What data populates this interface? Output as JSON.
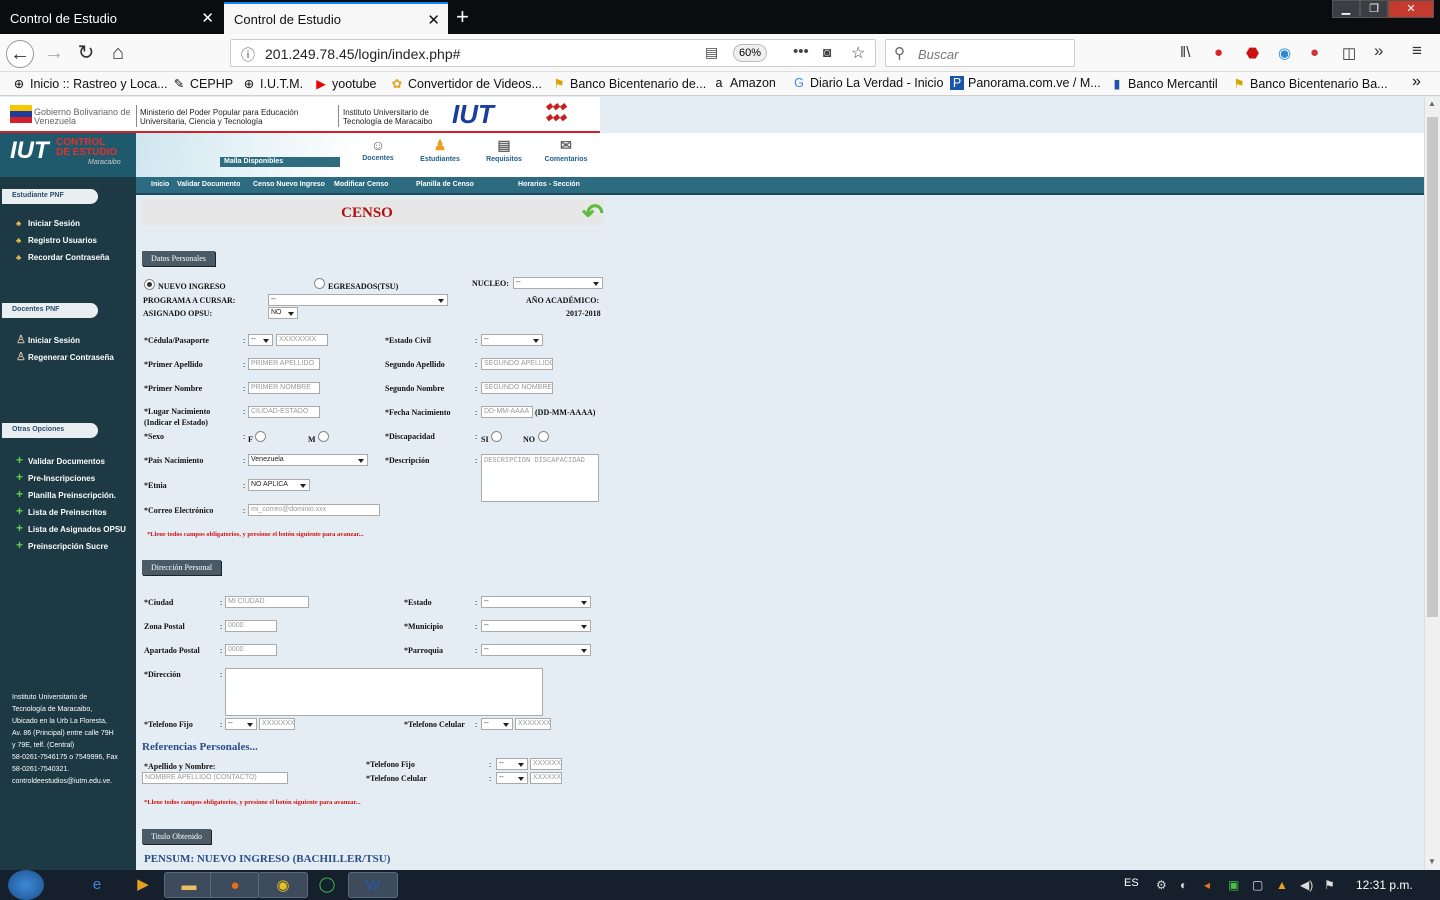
{
  "browser": {
    "tabs": [
      {
        "title": "Control de Estudio",
        "active": false
      },
      {
        "title": "Control de Estudio",
        "active": true
      }
    ],
    "url": "201.249.78.45/login/index.php#",
    "zoom": "60%",
    "search_placeholder": "Buscar",
    "bookmarks": [
      "Inicio :: Rastreo y Loca...",
      "CEPHP",
      "I.U.T.M.",
      "yootube",
      "Convertidor de Videos...",
      "Banco Bicentenario de...",
      "Amazon",
      "Diario La Verdad - Inicio",
      "Panorama.com.ve / M...",
      "Banco Mercantil",
      "Banco Bicentenario Ba..."
    ]
  },
  "banner": {
    "gob": "Gobierno Bolivariano de Venezuela",
    "ministerio": "Ministerio del Poder Popular para Educación Universitaria, Ciencia y Tecnología",
    "instituto": "Instituto Universitario de Tecnología de Maracaibo"
  },
  "header": {
    "logo_top": "CONTROL",
    "logo_mid": "DE ESTUDIO",
    "logo_city": "Maracaibo",
    "malla": "Malla Disponibles",
    "icons": [
      "Docentes",
      "Estudiantes",
      "Requisitos",
      "Comentarios"
    ]
  },
  "menu": [
    "Inicio",
    "Validar Documento",
    "Censo Nuevo Ingreso",
    "Modificar Censo",
    "Planilla de Censo",
    "Horarios - Sección"
  ],
  "sidebar": {
    "sections": [
      {
        "title": "Estudiante PNF",
        "items": [
          "Iniciar Sesión",
          "Registro Usuarios",
          "Recordar Contraseña"
        ]
      },
      {
        "title": "Docentes PNF",
        "items": [
          "Iniciar Sesión",
          "Regenerar Contraseña"
        ]
      },
      {
        "title": "Otras Opciones",
        "items": [
          "Validar Documentos",
          "Pre-Inscripciones",
          "Planilla Preinscripción.",
          "Lista de Preinscritos",
          "Lista de Asignados OPSU",
          "Preinscripción Sucre"
        ]
      }
    ],
    "footer": [
      "Instituto Universitario de",
      "Tecnología de Maracaibo,",
      "Ubicado en la Urb La Floresta,",
      "Av. 86 (Principal) entre calle 79H",
      "y 79E, telf. (Central)",
      "58-0261-7546175 o 7549996, Fax",
      "58-0261-7540321.",
      "controldeestudios@iutm.edu.ve."
    ]
  },
  "form": {
    "title": "CENSO",
    "datos_personales": "Datos Personales",
    "nuevo_ingreso": "NUEVO INGRESO",
    "egresados": "EGRESADOS(TSU)",
    "nucleo_label": "NUCLEO:",
    "nucleo_value": "--",
    "programa_label": "PROGRAMA A CURSAR:",
    "programa_value": "--",
    "ano_label": "AÑO ACADÉMICO:",
    "ano_value": "2017-2018",
    "opsu_label": "ASIGNADO OPSU:",
    "opsu_value": "NO",
    "cedula_label": "*Cédula/Pasaporte",
    "cedula_prefix": "--",
    "cedula_ph": "XXXXXXXX",
    "estado_civil_label": "*Estado Civil",
    "estado_civil_value": "--",
    "primer_apellido_label": "*Primer Apellido",
    "primer_apellido_ph": "PRIMER APELLIDO",
    "segundo_apellido_label": "Segundo Apellido",
    "segundo_apellido_ph": "SEGUNDO APELLIDO",
    "primer_nombre_label": "*Primer Nombre",
    "primer_nombre_ph": "PRIMER NOMBRE",
    "segundo_nombre_label": "Segundo Nombre",
    "segundo_nombre_ph": "SEGUNDO NOMBRE",
    "lugar_label": "*Lugar Nacimiento",
    "lugar_label2": "(Indicar el Estado)",
    "lugar_ph": "CIUDAD-ESTADO",
    "fecha_label": "*Fecha Nacimiento",
    "fecha_ph": "DD-MM-AAAA",
    "fecha_hint": "(DD-MM-AAAA)",
    "sexo_label": "*Sexo",
    "sexo_f": "F",
    "sexo_m": "M",
    "discapacidad_label": "*Discapacidad",
    "disc_si": "SI",
    "disc_no": "NO",
    "pais_label": "*País Nacimiento",
    "pais_value": "Venezuela",
    "descripcion_label": "*Descripción",
    "descripcion_ph": "DESCRIPCION DISCAPACIDAD",
    "etnia_label": "*Etnia",
    "etnia_value": "NO APLICA",
    "correo_label": "*Correo Electrónico",
    "correo_ph": "mi_correo@dominio.xxx",
    "note": "*Llene todos campos obligatorios, y presione el botón siguiente para avanzar...",
    "direccion_personal": "Dirección Personal",
    "ciudad_label": "*Ciudad",
    "ciudad_ph": "MI CIUDAD",
    "estado_label": "*Estado",
    "estado_value": "--",
    "zona_label": "Zona Postal",
    "zona_ph": "0000",
    "municipio_label": "*Municipio",
    "municipio_value": "--",
    "apartado_label": "Apartado Postal",
    "apartado_ph": "0000",
    "parroquia_label": "*Parroquia",
    "parroquia_value": "--",
    "direccion_label": "*Dirección",
    "tel_fijo_label": "*Telefono Fijo",
    "tel_fijo_prefix": "--",
    "tel_fijo_ph": "XXXXXXX",
    "tel_cel_label": "*Telefono Celular",
    "tel_cel_prefix": "--",
    "tel_cel_ph": "XXXXXXX",
    "referencias": "Referencias Personales...",
    "ref_nombre_label": "*Apellido y Nombre:",
    "ref_nombre_ph": "NOMBRE APELLIDO (CONTACTO)",
    "ref_fijo_label": "*Telefono Fijo",
    "ref_fijo_prefix": "--",
    "ref_fijo_ph": "XXXXXX",
    "ref_cel_label": "*Telefono Celular",
    "ref_cel_prefix": "--",
    "ref_cel_ph": "XXXXXX",
    "titulo_obtenido": "Titulo Obtenido",
    "pensum": "PENSUM: NUEVO INGRESO (BACHILLER/TSU)"
  },
  "taskbar": {
    "lang": "ES",
    "time": "12:31 p.m."
  }
}
